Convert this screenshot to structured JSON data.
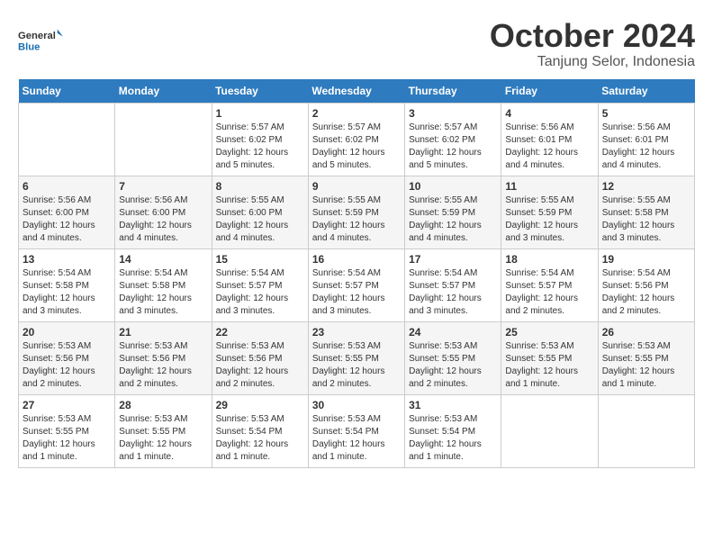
{
  "logo": {
    "line1": "General",
    "line2": "Blue"
  },
  "title": "October 2024",
  "subtitle": "Tanjung Selor, Indonesia",
  "headers": [
    "Sunday",
    "Monday",
    "Tuesday",
    "Wednesday",
    "Thursday",
    "Friday",
    "Saturday"
  ],
  "weeks": [
    [
      {
        "num": "",
        "info": ""
      },
      {
        "num": "",
        "info": ""
      },
      {
        "num": "1",
        "info": "Sunrise: 5:57 AM\nSunset: 6:02 PM\nDaylight: 12 hours\nand 5 minutes."
      },
      {
        "num": "2",
        "info": "Sunrise: 5:57 AM\nSunset: 6:02 PM\nDaylight: 12 hours\nand 5 minutes."
      },
      {
        "num": "3",
        "info": "Sunrise: 5:57 AM\nSunset: 6:02 PM\nDaylight: 12 hours\nand 5 minutes."
      },
      {
        "num": "4",
        "info": "Sunrise: 5:56 AM\nSunset: 6:01 PM\nDaylight: 12 hours\nand 4 minutes."
      },
      {
        "num": "5",
        "info": "Sunrise: 5:56 AM\nSunset: 6:01 PM\nDaylight: 12 hours\nand 4 minutes."
      }
    ],
    [
      {
        "num": "6",
        "info": "Sunrise: 5:56 AM\nSunset: 6:00 PM\nDaylight: 12 hours\nand 4 minutes."
      },
      {
        "num": "7",
        "info": "Sunrise: 5:56 AM\nSunset: 6:00 PM\nDaylight: 12 hours\nand 4 minutes."
      },
      {
        "num": "8",
        "info": "Sunrise: 5:55 AM\nSunset: 6:00 PM\nDaylight: 12 hours\nand 4 minutes."
      },
      {
        "num": "9",
        "info": "Sunrise: 5:55 AM\nSunset: 5:59 PM\nDaylight: 12 hours\nand 4 minutes."
      },
      {
        "num": "10",
        "info": "Sunrise: 5:55 AM\nSunset: 5:59 PM\nDaylight: 12 hours\nand 4 minutes."
      },
      {
        "num": "11",
        "info": "Sunrise: 5:55 AM\nSunset: 5:59 PM\nDaylight: 12 hours\nand 3 minutes."
      },
      {
        "num": "12",
        "info": "Sunrise: 5:55 AM\nSunset: 5:58 PM\nDaylight: 12 hours\nand 3 minutes."
      }
    ],
    [
      {
        "num": "13",
        "info": "Sunrise: 5:54 AM\nSunset: 5:58 PM\nDaylight: 12 hours\nand 3 minutes."
      },
      {
        "num": "14",
        "info": "Sunrise: 5:54 AM\nSunset: 5:58 PM\nDaylight: 12 hours\nand 3 minutes."
      },
      {
        "num": "15",
        "info": "Sunrise: 5:54 AM\nSunset: 5:57 PM\nDaylight: 12 hours\nand 3 minutes."
      },
      {
        "num": "16",
        "info": "Sunrise: 5:54 AM\nSunset: 5:57 PM\nDaylight: 12 hours\nand 3 minutes."
      },
      {
        "num": "17",
        "info": "Sunrise: 5:54 AM\nSunset: 5:57 PM\nDaylight: 12 hours\nand 3 minutes."
      },
      {
        "num": "18",
        "info": "Sunrise: 5:54 AM\nSunset: 5:57 PM\nDaylight: 12 hours\nand 2 minutes."
      },
      {
        "num": "19",
        "info": "Sunrise: 5:54 AM\nSunset: 5:56 PM\nDaylight: 12 hours\nand 2 minutes."
      }
    ],
    [
      {
        "num": "20",
        "info": "Sunrise: 5:53 AM\nSunset: 5:56 PM\nDaylight: 12 hours\nand 2 minutes."
      },
      {
        "num": "21",
        "info": "Sunrise: 5:53 AM\nSunset: 5:56 PM\nDaylight: 12 hours\nand 2 minutes."
      },
      {
        "num": "22",
        "info": "Sunrise: 5:53 AM\nSunset: 5:56 PM\nDaylight: 12 hours\nand 2 minutes."
      },
      {
        "num": "23",
        "info": "Sunrise: 5:53 AM\nSunset: 5:55 PM\nDaylight: 12 hours\nand 2 minutes."
      },
      {
        "num": "24",
        "info": "Sunrise: 5:53 AM\nSunset: 5:55 PM\nDaylight: 12 hours\nand 2 minutes."
      },
      {
        "num": "25",
        "info": "Sunrise: 5:53 AM\nSunset: 5:55 PM\nDaylight: 12 hours\nand 1 minute."
      },
      {
        "num": "26",
        "info": "Sunrise: 5:53 AM\nSunset: 5:55 PM\nDaylight: 12 hours\nand 1 minute."
      }
    ],
    [
      {
        "num": "27",
        "info": "Sunrise: 5:53 AM\nSunset: 5:55 PM\nDaylight: 12 hours\nand 1 minute."
      },
      {
        "num": "28",
        "info": "Sunrise: 5:53 AM\nSunset: 5:55 PM\nDaylight: 12 hours\nand 1 minute."
      },
      {
        "num": "29",
        "info": "Sunrise: 5:53 AM\nSunset: 5:54 PM\nDaylight: 12 hours\nand 1 minute."
      },
      {
        "num": "30",
        "info": "Sunrise: 5:53 AM\nSunset: 5:54 PM\nDaylight: 12 hours\nand 1 minute."
      },
      {
        "num": "31",
        "info": "Sunrise: 5:53 AM\nSunset: 5:54 PM\nDaylight: 12 hours\nand 1 minute."
      },
      {
        "num": "",
        "info": ""
      },
      {
        "num": "",
        "info": ""
      }
    ]
  ]
}
